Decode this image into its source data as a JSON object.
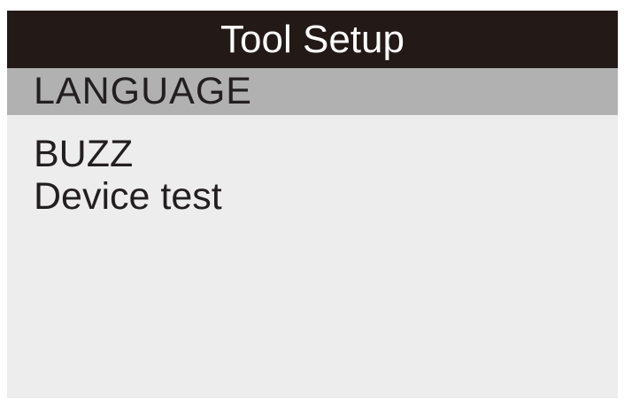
{
  "screen": {
    "title": "Tool Setup",
    "menu": {
      "items": [
        {
          "label": "LANGUAGE",
          "selected": true
        },
        {
          "label": "BUZZ",
          "selected": false
        },
        {
          "label": "Device test",
          "selected": false
        }
      ]
    }
  },
  "colors": {
    "title_background": "#231a17",
    "title_text": "#ffffff",
    "highlight": "#b1b1b1",
    "screen_background": "#ededed",
    "text": "#231f20"
  }
}
